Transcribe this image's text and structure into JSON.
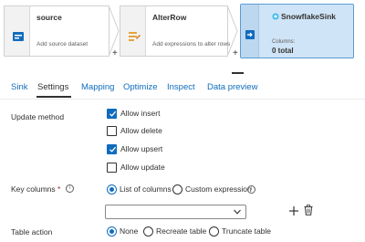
{
  "flow": {
    "nodes": [
      {
        "title": "source",
        "description": "Add source dataset",
        "icon": "source-icon"
      },
      {
        "title": "AlterRow",
        "description": "Add expressions to alter rows",
        "icon": "alter-row-icon"
      }
    ],
    "sink": {
      "title": "SnowflakeSink",
      "columns_label": "Columns:",
      "columns_value": "0 total",
      "icon": "sink-icon"
    },
    "add_symbol": "+"
  },
  "tabs": [
    "Sink",
    "Settings",
    "Mapping",
    "Optimize",
    "Inspect",
    "Data preview"
  ],
  "active_tab": "Settings",
  "settings": {
    "update_method": {
      "label": "Update method",
      "options": [
        {
          "label": "Allow insert",
          "checked": true
        },
        {
          "label": "Allow delete",
          "checked": false
        },
        {
          "label": "Allow upsert",
          "checked": true
        },
        {
          "label": "Allow update",
          "checked": false
        }
      ]
    },
    "key_columns": {
      "label": "Key columns",
      "required_mark": "*",
      "options": [
        {
          "label": "List of columns",
          "selected": true
        },
        {
          "label": "Custom expression",
          "selected": false
        }
      ],
      "select_value": ""
    },
    "table_action": {
      "label": "Table action",
      "options": [
        {
          "label": "None",
          "selected": true
        },
        {
          "label": "Recreate table",
          "selected": false
        },
        {
          "label": "Truncate table",
          "selected": false
        }
      ]
    }
  },
  "colors": {
    "accent": "#0f6cbd",
    "sink_fill": "#cfe4f6",
    "sink_border": "#5b9bd5"
  }
}
